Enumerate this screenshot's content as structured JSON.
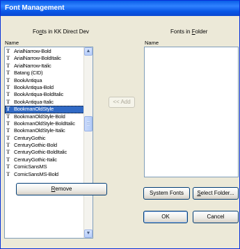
{
  "window": {
    "title": "Font Management"
  },
  "left_panel": {
    "title_pre": "Fo",
    "title_u": "n",
    "title_post": "ts in KK Direct Dev",
    "list_header": "Name",
    "items": [
      "ArialNarrow-Bold",
      "ArialNarrow-BoldItalic",
      "ArialNarrow-Italic",
      "Batang (CID)",
      "BookAntiqua",
      "BookAntiqua-Bold",
      "BookAntiqua-BoldItalic",
      "BookAntiqua-Italic",
      "BookmanOldStyle",
      "BookmanOldStyle-Bold",
      "BookmanOldStyle-BoldItalic",
      "BookmanOldStyle-Italic",
      "CenturyGothic",
      "CenturyGothic-Bold",
      "CenturyGothic-BoldItalic",
      "CenturyGothic-Italic",
      "ComicSansMS",
      "ComicSansMS-Bold"
    ],
    "selected_item": "BookmanOldStyle",
    "font_icon_glyph": "T",
    "remove_pre": "",
    "remove_u": "R",
    "remove_post": "emove"
  },
  "right_panel": {
    "title_pre": "Fonts in ",
    "title_u": "F",
    "title_post": "older",
    "list_header": "Name"
  },
  "add_button": "<< Add",
  "system_fonts_button": "System Fonts",
  "select_folder_pre": "",
  "select_folder_u": "S",
  "select_folder_post": "elect Folder...",
  "ok_button": "OK",
  "cancel_button": "Cancel",
  "scroll_up_glyph": "▲",
  "scroll_down_glyph": "▼"
}
